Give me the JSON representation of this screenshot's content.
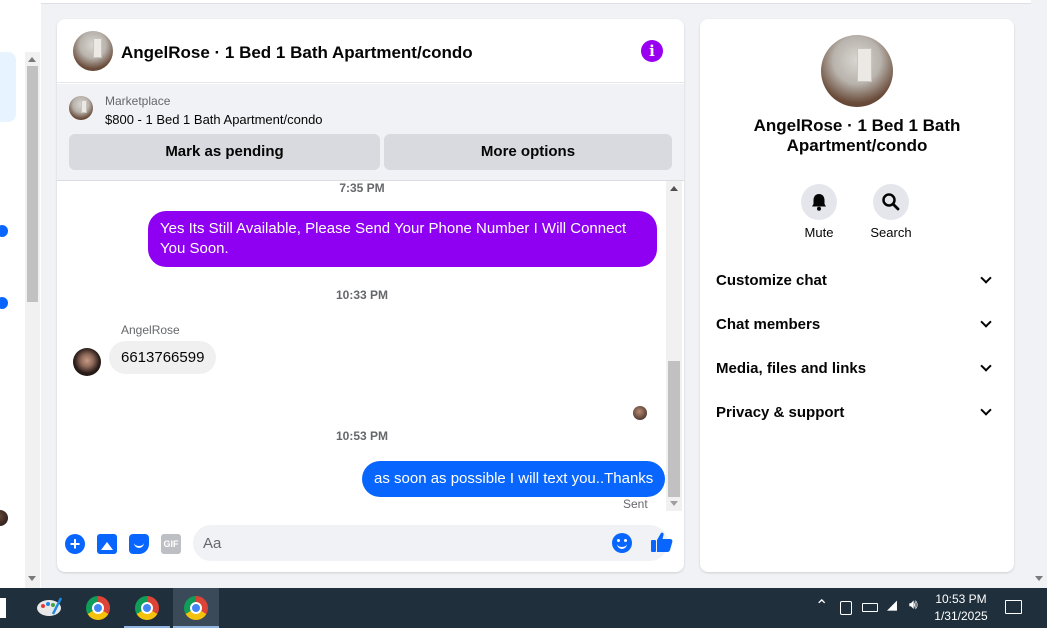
{
  "chat": {
    "title": "AngelRose · 1 Bed 1 Bath Apartment/condo",
    "marketplace": {
      "label": "Marketplace",
      "listing": "$800 - 1 Bed 1 Bath Apartment/condo",
      "mark_pending": "Mark as pending",
      "more_options": "More options"
    },
    "messages": [
      {
        "type": "time",
        "text": "7:35 PM"
      },
      {
        "type": "out",
        "text": "Yes Its Still Available, Please Send Your Phone Number I Will Connect You Soon."
      },
      {
        "type": "time",
        "text": "10:33 PM"
      },
      {
        "type": "in",
        "sender": "AngelRose",
        "text": "6613766599"
      },
      {
        "type": "time",
        "text": "10:53 PM"
      },
      {
        "type": "out",
        "text": "as soon as possible I will text you..Thanks",
        "status": "Sent"
      }
    ],
    "composer": {
      "placeholder": "Aa",
      "gif_label": "GIF"
    }
  },
  "info_panel": {
    "title": "AngelRose · 1 Bed 1 Bath Apartment/condo",
    "actions": [
      {
        "label": "Mute",
        "icon": "bell-icon"
      },
      {
        "label": "Search",
        "icon": "search-icon"
      }
    ],
    "sections": [
      "Customize chat",
      "Chat members",
      "Media, files and links",
      "Privacy & support"
    ]
  },
  "taskbar": {
    "time": "10:53 PM",
    "date": "1/31/2025"
  },
  "colors": {
    "accent_blue": "#0866ff",
    "accent_purple": "#9a00f0",
    "bubble_purple": "#8f00f2"
  }
}
